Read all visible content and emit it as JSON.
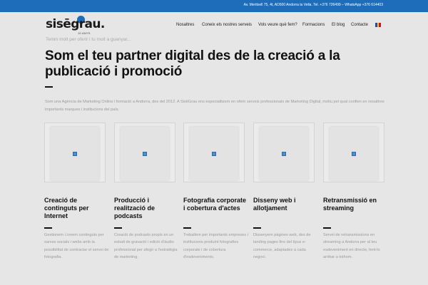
{
  "topbar": {
    "contact": "Av. Meritxell 75, 4t, AD500 Andorra la Vella. Tel. +376 726499 – WhatsApp +376 614403"
  },
  "logo": {
    "wordmark": "sisēgrau.",
    "sub": "10 ANYS"
  },
  "nav": {
    "items": [
      {
        "label": "Nosaltres"
      },
      {
        "label": "Coneix els nostres serveis"
      },
      {
        "label": "Vols veure què fem?"
      },
      {
        "label": "Formacions"
      },
      {
        "label": "El blog"
      },
      {
        "label": "Contacte"
      }
    ],
    "language_flag": "flag-andorra-icon"
  },
  "scroll_note": "Tenim molt per oferir i tu molt a guanyar...",
  "hero": {
    "title": "Som el teu partner digital des de la creació a la publicació i promoció",
    "intro": "Som una Agència de Marketing Online i formació a Andorra, des del 2012. A SisēGrau ens especialitzem en oferir serveis professionals de Marketing Digital, motiu pel qual confien en nosaltres importants marques i institucions del país."
  },
  "services": [
    {
      "title": "Creació de continguts per Internet",
      "desc": "Gestionem i creem continguts per xarxes socials i webs amb la possibilitat de contractar el servei de fotografia."
    },
    {
      "title": "Producció i realització de podcasts",
      "desc": "Creació de podcasts propis en un estudi de gravació i edició d'àudio professional per afegir a l'estratègia de marketing."
    },
    {
      "title": "Fotografia corporate i cobertura d'actes",
      "desc": "Treballem per importants empreses i institucions produint fotografies corporate i de cobertura d'esdeveniments."
    },
    {
      "title": "Disseny web i allotjament",
      "desc": "Dissenyem pàgines web, des de landing pages fins del tipus e-commerce, adaptades a cada negoci."
    },
    {
      "title": "Retransmissió en streaming",
      "desc": "Servei de retransmissions en streaming a Andorra per al teu esdeveniment en directe, fent-lo arribar a tothom."
    }
  ],
  "colors": {
    "brand_blue": "#1e6dbb",
    "background": "#e6e6e6",
    "text_dark": "#111111",
    "text_muted": "#9a9a9a"
  }
}
